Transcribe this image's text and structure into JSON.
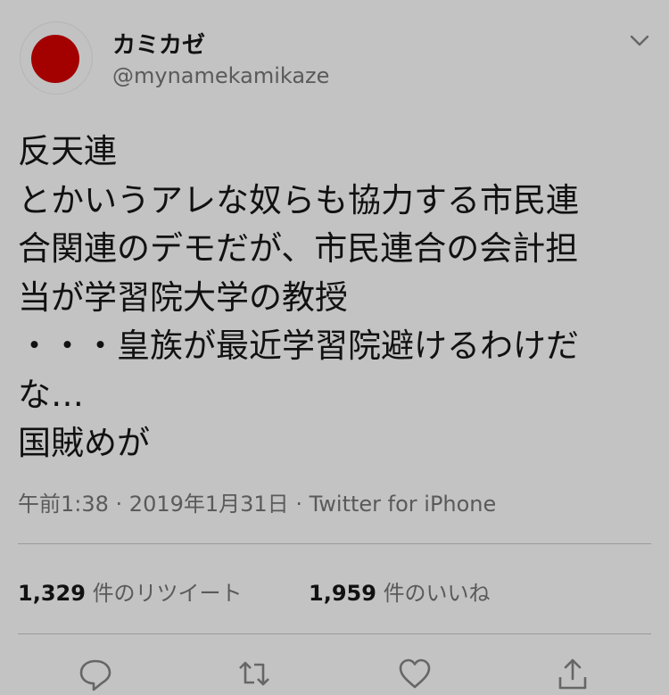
{
  "tweet": {
    "display_name": "カミカゼ",
    "handle": "@mynamekamikaze",
    "avatar": {
      "icon": "japan-flag-icon",
      "sun_color": "#a30000"
    },
    "menu_icon": "chevron-down-icon",
    "text_lines": [
      "反天連",
      "とかいうアレな奴らも協力する市民連",
      "合関連のデモだが、市民連合の会計担",
      "当が学習院大学の教授",
      "・・・皇族が最近学習院避けるわけだ",
      "な…",
      "国賊めが"
    ],
    "meta": {
      "time": "午前1:38",
      "date": "2019年1月31日",
      "source": "Twitter for iPhone",
      "separator": " · "
    },
    "stats": {
      "retweets": {
        "count": "1,329",
        "label": "件のリツイート"
      },
      "likes": {
        "count": "1,959",
        "label": "件のいいね"
      }
    },
    "actions": [
      {
        "name": "reply",
        "icon": "reply-icon"
      },
      {
        "name": "retweet",
        "icon": "retweet-icon"
      },
      {
        "name": "like",
        "icon": "heart-icon"
      },
      {
        "name": "share",
        "icon": "share-icon"
      }
    ]
  }
}
